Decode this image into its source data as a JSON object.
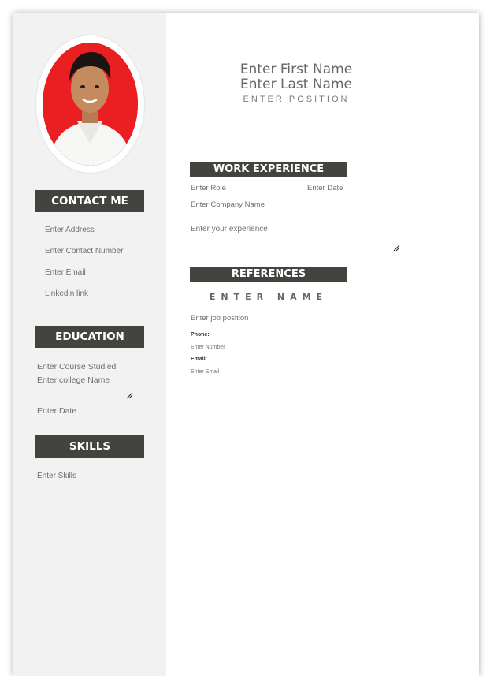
{
  "sidebar": {
    "contact_heading": "CONTACT ME",
    "contact_items": [
      "Enter Address",
      "Enter Contact Number",
      "Enter Email",
      "Linkedin link"
    ],
    "education_heading": "EDUCATION",
    "education": {
      "course": "Enter Course Studied",
      "college": "Enter college Name",
      "date": "Enter Date"
    },
    "skills_heading": "SKILLS",
    "skills": "Enter Skills"
  },
  "header": {
    "first_name": "Enter First Name",
    "last_name": "Enter Last Name",
    "position": "ENTER POSITION"
  },
  "work": {
    "heading": "WORK EXPERIENCE",
    "role": "Enter Role",
    "date": "Enter Date",
    "company": "Enter Company Name",
    "experience": "Enter your experience"
  },
  "references": {
    "heading": "REFERENCES",
    "name": "ENTER NAME",
    "job_position": "Enter job position",
    "phone_label": "Phone:",
    "phone_value": "Enter Number",
    "email_label": "Email:",
    "email_value": "Enter Email"
  },
  "colors": {
    "heading_bg": "#43443f",
    "sidebar_bg": "#f2f2f2",
    "photo_bg": "#ea1f22"
  },
  "icons": {
    "resize": "resize-handle-icon"
  }
}
